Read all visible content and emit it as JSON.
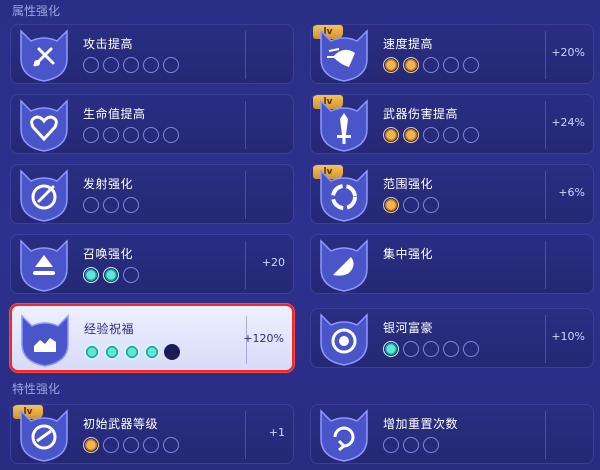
{
  "sections": {
    "attribute": "属性强化",
    "trait": "特性强化"
  },
  "cards": [
    {
      "title": "攻击提高",
      "pips": [
        "empty",
        "empty",
        "empty",
        "empty",
        "empty"
      ],
      "value": "",
      "badge": "",
      "icon": "sword-shield-icon"
    },
    {
      "title": "速度提高",
      "pips": [
        "orange",
        "orange",
        "empty",
        "empty",
        "empty"
      ],
      "value": "+20%",
      "badge": "lv",
      "icon": "speed-icon"
    },
    {
      "title": "生命值提高",
      "pips": [
        "empty",
        "empty",
        "empty",
        "empty",
        "empty"
      ],
      "value": "",
      "badge": "",
      "icon": "heart-icon"
    },
    {
      "title": "武器伤害提高",
      "pips": [
        "orange",
        "orange",
        "empty",
        "empty",
        "empty"
      ],
      "value": "+24%",
      "badge": "lv",
      "icon": "sword-icon"
    },
    {
      "title": "发射强化",
      "pips": [
        "empty",
        "empty",
        "empty"
      ],
      "value": "",
      "badge": "",
      "icon": "launch-icon"
    },
    {
      "title": "范围强化",
      "pips": [
        "orange",
        "empty",
        "empty"
      ],
      "value": "+6%",
      "badge": "lv",
      "icon": "ring-icon"
    },
    {
      "title": "召唤强化",
      "pips": [
        "teal",
        "teal",
        "empty"
      ],
      "value": "+20",
      "badge": "",
      "icon": "summon-icon"
    },
    {
      "title": "集中强化",
      "pips": [],
      "value": "",
      "badge": "",
      "icon": "focus-icon"
    },
    {
      "title": "经验祝福",
      "pips": [
        "teal",
        "teal",
        "teal",
        "teal",
        "dark"
      ],
      "value": "+120%",
      "badge": "",
      "icon": "exp-icon",
      "highlight": true
    },
    {
      "title": "银河富豪",
      "pips": [
        "teal",
        "empty",
        "empty",
        "empty",
        "empty"
      ],
      "value": "+10%",
      "badge": "",
      "icon": "coin-icon"
    },
    {
      "title": "初始武器等级",
      "pips": [
        "orange",
        "empty",
        "empty",
        "empty",
        "empty"
      ],
      "value": "+1",
      "badge": "lv",
      "icon": "weapon-level-icon"
    },
    {
      "title": "增加重置次数",
      "pips": [
        "empty",
        "empty",
        "empty"
      ],
      "value": "",
      "badge": "",
      "icon": "reset-icon"
    }
  ]
}
